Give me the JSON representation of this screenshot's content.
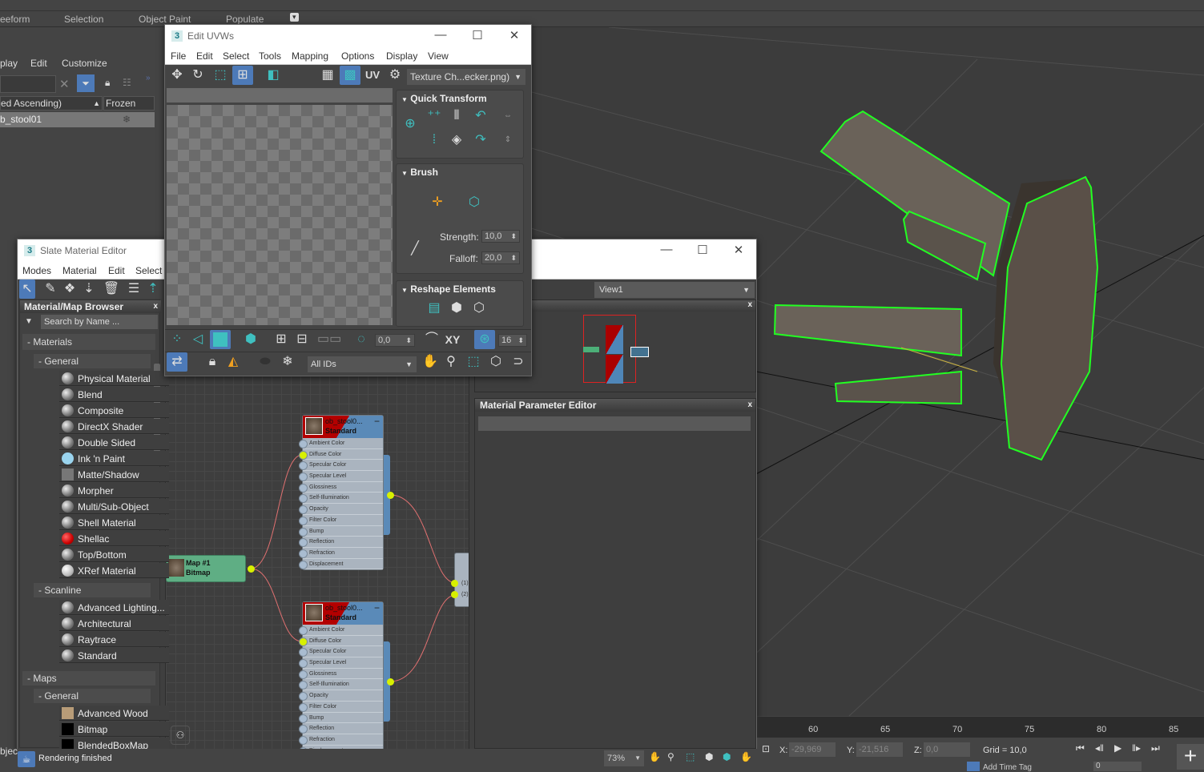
{
  "ribbon": {
    "tabs": [
      "eeform",
      "Selection",
      "Object Paint",
      "Populate"
    ]
  },
  "scene_explorer": {
    "menu": [
      "play",
      "Edit",
      "Customize"
    ],
    "columns": {
      "name": "ed Ascending)",
      "frozen": "Frozen"
    },
    "rows": [
      {
        "name": "b_stool01"
      }
    ]
  },
  "uvw": {
    "title": "Edit UVWs",
    "menu": [
      "File",
      "Edit",
      "Select",
      "Tools",
      "Mapping",
      "Options",
      "Display",
      "View"
    ],
    "texture_dropdown": "Texture Ch...ecker.png)",
    "uv_label": "UV",
    "quick_transform": "Quick Transform",
    "brush": {
      "title": "Brush",
      "strength_label": "Strength:",
      "strength": "10,0",
      "falloff_label": "Falloff:",
      "falloff": "20,0"
    },
    "reshape": "Reshape Elements",
    "bottom": {
      "value": "0,0",
      "xy": "XY",
      "grid": "16",
      "ids": "All IDs"
    }
  },
  "slate": {
    "title": "Slate Material Editor",
    "menu": [
      "Modes",
      "Material",
      "Edit",
      "Select"
    ],
    "view_dropdown": "View1",
    "browser": {
      "title": "Material/Map Browser",
      "search_placeholder": "Search by Name ...",
      "materials_label": "- Materials",
      "general_label": "- General",
      "general": [
        "Physical Material",
        "Blend",
        "Composite",
        "DirectX Shader",
        "Double Sided",
        "Ink 'n Paint",
        "Matte/Shadow",
        "Morpher",
        "Multi/Sub-Object",
        "Shell Material",
        "Shellac",
        "Top/Bottom",
        "XRef Material"
      ],
      "scanline_label": "- Scanline",
      "scanline": [
        "Advanced Lighting...",
        "Architectural",
        "Raytrace",
        "Standard"
      ],
      "maps_label": "- Maps",
      "maps_general_label": "- General",
      "maps": [
        "Advanced Wood",
        "Bitmap",
        "BlendedBoxMap"
      ]
    },
    "nodes": {
      "mat_name": "ob_stool0...",
      "mat_type": "Standard",
      "slots": [
        "Ambient Color",
        "Diffuse Color",
        "Specular Color",
        "Specular Level",
        "Glossiness",
        "Self-Illumination",
        "Opacity",
        "Filter Color",
        "Bump",
        "Reflection",
        "Refraction",
        "Displacement"
      ],
      "map_name": "Map #1",
      "map_type": "Bitmap",
      "multi_slots": [
        "(1)",
        "(2)"
      ]
    },
    "param_editor": "Material Parameter Editor",
    "zoom": "73%",
    "status": "Rendering finished"
  },
  "status": {
    "x_label": "X:",
    "x": "-29,969",
    "y_label": "Y:",
    "y": "-21,516",
    "z_label": "Z:",
    "z": "0,0",
    "grid": "Grid = 10,0",
    "frame": "0",
    "time_tag": "Add Time Tag"
  },
  "timeline": {
    "ticks": [
      "60",
      "65",
      "70",
      "75",
      "80",
      "85"
    ]
  },
  "left_status": {
    "text": "bjec"
  }
}
